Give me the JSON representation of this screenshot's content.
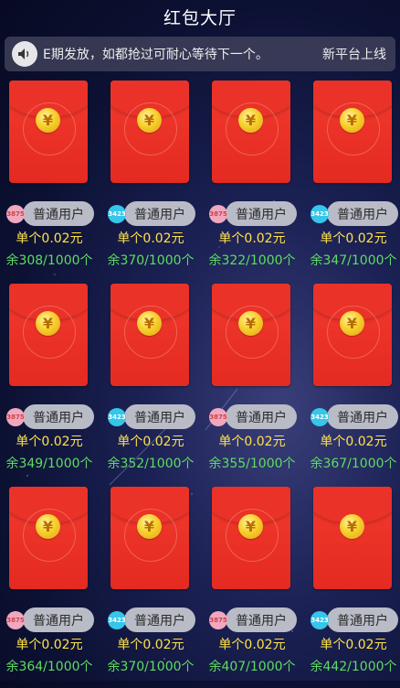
{
  "header": {
    "title": "红包大厅"
  },
  "notice": {
    "icon": "speaker-icon",
    "text": "E期发放，如都抢过可耐心等待下一个。",
    "right_text": "新平台上线"
  },
  "colors": {
    "envelope": "#e42a21",
    "amount": "#ffe24a",
    "remain": "#5fdc63",
    "pill": "#b9bcc6"
  },
  "packets": [
    {
      "avatar": "3875",
      "avatar_color": "pink",
      "user_type": "普通用户",
      "amount": "单个0.02元",
      "remain": "余308/1000个"
    },
    {
      "avatar": "3423",
      "avatar_color": "cyan",
      "user_type": "普通用户",
      "amount": "单个0.02元",
      "remain": "余370/1000个"
    },
    {
      "avatar": "3875",
      "avatar_color": "pink",
      "user_type": "普通用户",
      "amount": "单个0.02元",
      "remain": "余322/1000个"
    },
    {
      "avatar": "3423",
      "avatar_color": "cyan",
      "user_type": "普通用户",
      "amount": "单个0.02元",
      "remain": "余347/1000个"
    },
    {
      "avatar": "3875",
      "avatar_color": "pink",
      "user_type": "普通用户",
      "amount": "单个0.02元",
      "remain": "余349/1000个"
    },
    {
      "avatar": "3423",
      "avatar_color": "cyan",
      "user_type": "普通用户",
      "amount": "单个0.02元",
      "remain": "余352/1000个"
    },
    {
      "avatar": "3875",
      "avatar_color": "pink",
      "user_type": "普通用户",
      "amount": "单个0.02元",
      "remain": "余355/1000个"
    },
    {
      "avatar": "3423",
      "avatar_color": "cyan",
      "user_type": "普通用户",
      "amount": "单个0.02元",
      "remain": "余367/1000个"
    },
    {
      "avatar": "3875",
      "avatar_color": "pink",
      "user_type": "普通用户",
      "amount": "单个0.02元",
      "remain": "余364/1000个"
    },
    {
      "avatar": "3423",
      "avatar_color": "cyan",
      "user_type": "普通用户",
      "amount": "单个0.02元",
      "remain": "余370/1000个"
    },
    {
      "avatar": "3875",
      "avatar_color": "pink",
      "user_type": "普通用户",
      "amount": "单个0.02元",
      "remain": "余407/1000个"
    },
    {
      "avatar": "3423",
      "avatar_color": "cyan",
      "user_type": "普通用户",
      "amount": "单个0.02元",
      "remain": "余442/1000个"
    }
  ]
}
